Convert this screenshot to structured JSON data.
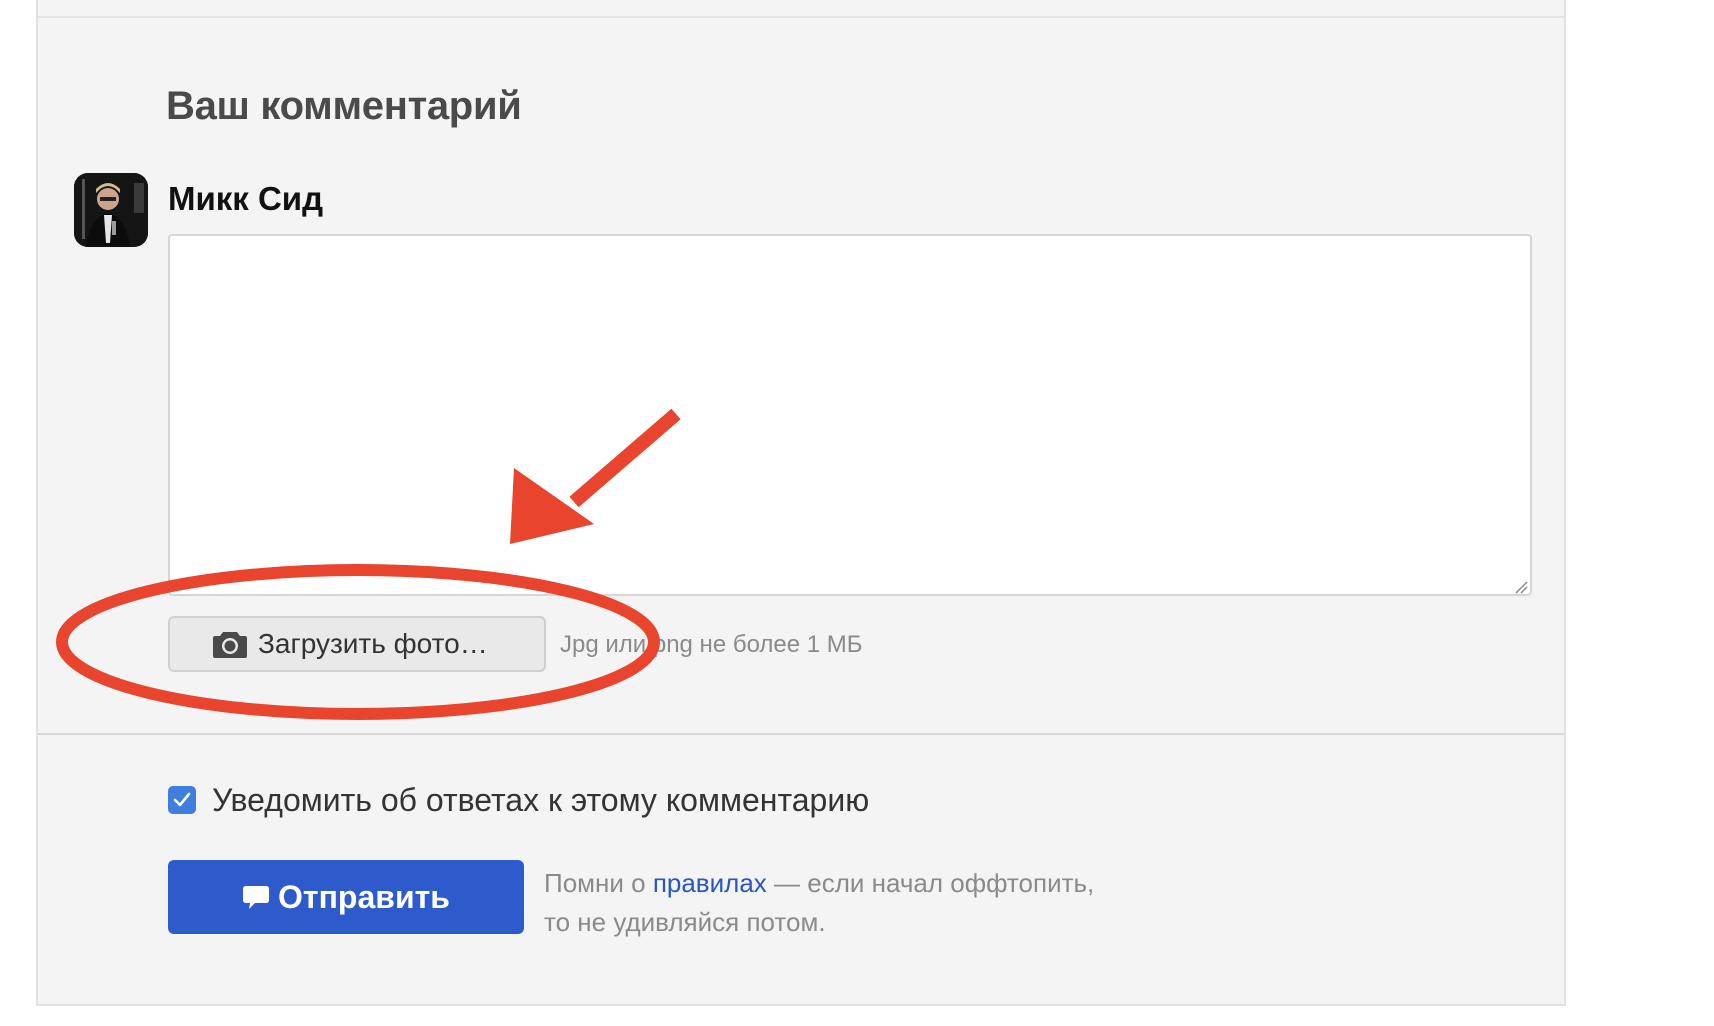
{
  "comment_form": {
    "title": "Ваш комментарий",
    "username": "Микк Сид",
    "textarea_value": "",
    "upload_button_label": "Загрузить фото…",
    "upload_hint": "Jpg или png не более 1 МБ",
    "notify_label": "Уведомить об ответах к этому комментарию",
    "notify_checked": true,
    "send_button_label": "Отправить",
    "rules_prefix": "Помни о ",
    "rules_link": "правилах",
    "rules_suffix": " — если начал оффтопить,",
    "rules_line2": "то не удивляйся потом."
  },
  "icons": {
    "upload": "camera-icon",
    "send": "speech-bubble-icon",
    "checkbox": "checkmark-icon"
  },
  "colors": {
    "panel_bg": "#f4f4f4",
    "primary_button": "#2e5bcb",
    "link": "#2a55c4",
    "checkbox": "#3f7de0",
    "annotation": "#e8442e"
  }
}
